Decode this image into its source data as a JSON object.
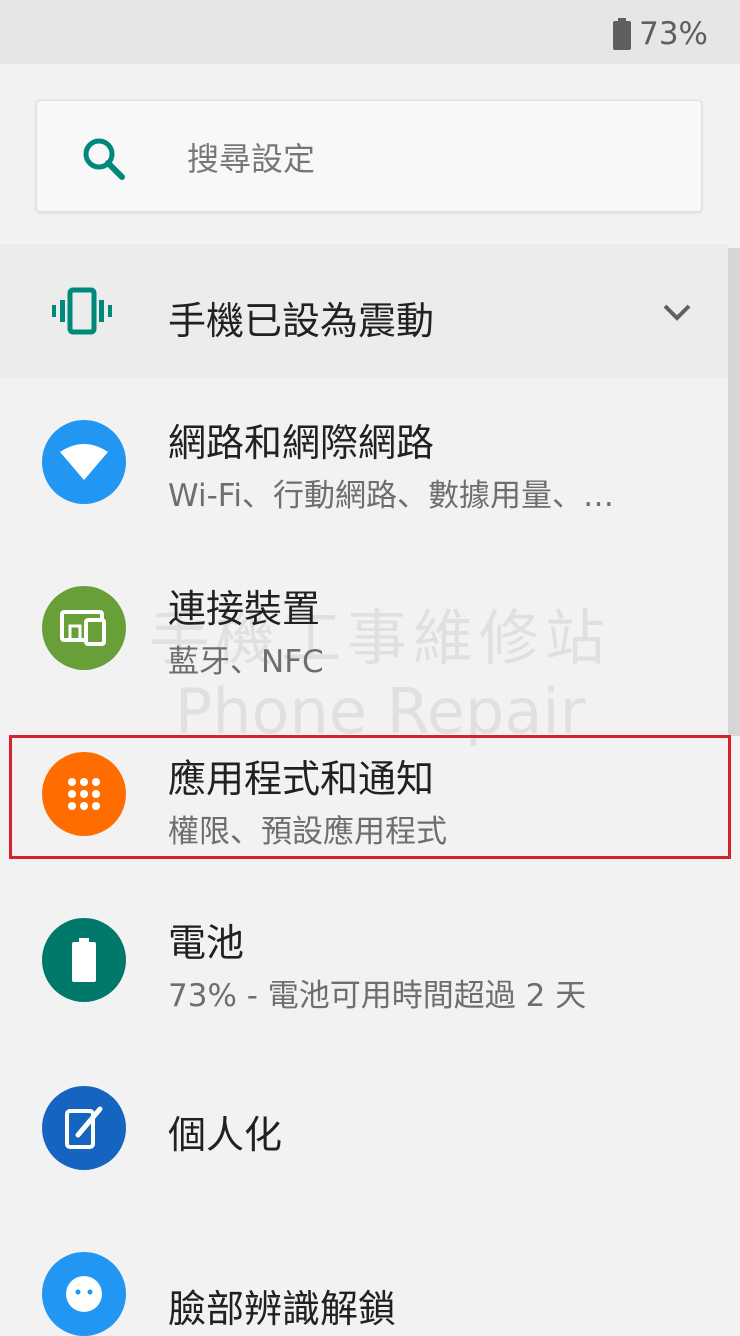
{
  "status_bar": {
    "battery_percent": "73%",
    "battery_icon": "battery-icon"
  },
  "search": {
    "placeholder": "搜尋設定",
    "icon": "search-icon"
  },
  "condition": {
    "label": "手機已設為震動",
    "icon": "vibrate-icon",
    "expand_icon": "chevron-down-icon"
  },
  "settings": [
    {
      "title": "網路和網際網路",
      "subtitle": "Wi-Fi、行動網路、數據用量、…",
      "icon": "wifi-icon",
      "color": "#2196f3"
    },
    {
      "title": "連接裝置",
      "subtitle": "藍牙、NFC",
      "icon": "devices-icon",
      "color": "#689f38"
    },
    {
      "title": "應用程式和通知",
      "subtitle": "權限、預設應用程式",
      "icon": "apps-icon",
      "color": "#ff6d00"
    },
    {
      "title": "電池",
      "subtitle": "73% - 電池可用時間超過 2 天",
      "icon": "battery-icon",
      "color": "#00796b"
    },
    {
      "title": "個人化",
      "subtitle": "",
      "icon": "personalize-icon",
      "color": "#1565c0"
    },
    {
      "title": "臉部辨識解鎖",
      "subtitle": "",
      "icon": "face-icon",
      "color": "#2196f3"
    }
  ],
  "watermark": {
    "line1": "手機工事維修站",
    "line2": "Phone Repair"
  },
  "colors": {
    "accent": "#00897b",
    "highlight": "#d6222e"
  }
}
